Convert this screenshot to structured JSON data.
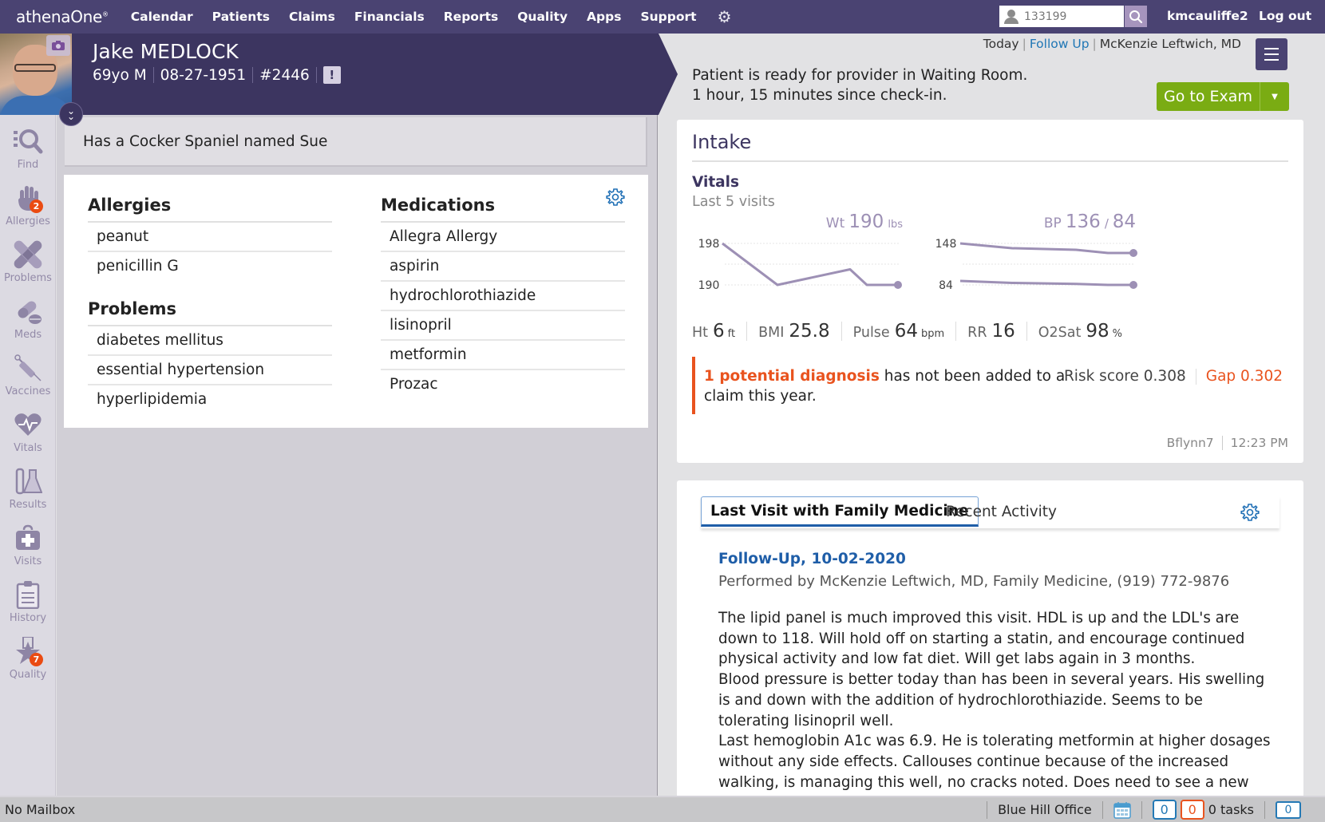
{
  "nav": {
    "logo": "athenaOne",
    "items": [
      "Calendar",
      "Patients",
      "Claims",
      "Financials",
      "Reports",
      "Quality",
      "Apps",
      "Support"
    ],
    "patient_search_value": "133199",
    "username": "kmcauliffe2",
    "logout": "Log out"
  },
  "patient": {
    "name": "Jake MEDLOCK",
    "age_sex": "69yo M",
    "dob": "08-27-1951",
    "id": "#2446",
    "alert_glyph": "!"
  },
  "encounter": {
    "when": "Today",
    "type": "Follow Up",
    "provider": "McKenzie Leftwich, MD",
    "status_line1": "Patient is ready for provider in Waiting Room.",
    "status_line2": "1 hour, 15 minutes since check-in.",
    "exam_button": "Go to Exam"
  },
  "sidebar": {
    "items": [
      {
        "label": "Find",
        "icon": "find-icon"
      },
      {
        "label": "Allergies",
        "icon": "hand-icon",
        "badge": "2"
      },
      {
        "label": "Problems",
        "icon": "bandage-icon"
      },
      {
        "label": "Meds",
        "icon": "pill-icon"
      },
      {
        "label": "Vaccines",
        "icon": "syringe-icon"
      },
      {
        "label": "Vitals",
        "icon": "heart-pulse-icon"
      },
      {
        "label": "Results",
        "icon": "flask-icon"
      },
      {
        "label": "Visits",
        "icon": "medical-bag-icon"
      },
      {
        "label": "History",
        "icon": "clipboard-icon"
      },
      {
        "label": "Quality",
        "icon": "star-icon",
        "badge": "7"
      }
    ]
  },
  "note": "Has a Cocker Spaniel named Sue",
  "allergies": {
    "title": "Allergies",
    "items": [
      "peanut",
      "penicillin G"
    ]
  },
  "problems": {
    "title": "Problems",
    "items": [
      "diabetes mellitus",
      "essential hypertension",
      "hyperlipidemia"
    ]
  },
  "medications": {
    "title": "Medications",
    "items": [
      "Allegra Allergy",
      "aspirin",
      "hydrochlorothiazide",
      "lisinopril",
      "metformin",
      "Prozac"
    ]
  },
  "intake": {
    "title": "Intake",
    "vitals_title": "Vitals",
    "vitals_sub": "Last 5 visits",
    "vitals": [
      {
        "label": "Ht",
        "value": "6",
        "unit": "ft"
      },
      {
        "label": "BMI",
        "value": "25.8",
        "unit": ""
      },
      {
        "label": "Pulse",
        "value": "64",
        "unit": "bpm"
      },
      {
        "label": "RR",
        "value": "16",
        "unit": ""
      },
      {
        "label": "O2Sat",
        "value": "98",
        "unit": "%"
      }
    ],
    "dx_highlight": "1 potential diagnosis",
    "dx_rest": " has not been added to a claim this year.",
    "risk_label": "Risk score 0.308",
    "gap_label": "Gap 0.302",
    "signed_by": "Bflynn7",
    "signed_time": "12:23 PM"
  },
  "chart_data": [
    {
      "type": "line",
      "title": "Wt 190 lbs",
      "label": "Wt",
      "current": "190",
      "unit": "lbs",
      "tick_labels": [
        "198",
        "190"
      ],
      "ylim": [
        190,
        198
      ],
      "x": [
        1,
        2,
        3,
        4,
        5
      ],
      "series": [
        {
          "name": "Weight",
          "values": [
            198,
            190,
            193,
            190,
            190
          ]
        }
      ]
    },
    {
      "type": "line",
      "title": "BP 136 / 84",
      "label": "BP",
      "current": "136",
      "current2": "84",
      "tick_labels": [
        "148",
        "84"
      ],
      "x": [
        1,
        2,
        3,
        4,
        5
      ],
      "series": [
        {
          "name": "Systolic",
          "values": [
            148,
            142,
            140,
            136,
            136
          ]
        },
        {
          "name": "Diastolic",
          "values": [
            88,
            86,
            85,
            84,
            84
          ]
        }
      ]
    }
  ],
  "visit": {
    "tabs": [
      "Last Visit with Family Medicine",
      "Recent Activity"
    ],
    "active_tab": 0,
    "link": "Follow-Up, 10-02-2020",
    "performed_by": "Performed by McKenzie Leftwich, MD, Family Medicine, (919) 772-9876",
    "paragraphs": [
      "The lipid panel is much improved this visit. HDL is up and the LDL's are down to 118. Will hold off on starting a statin, and encourage continued physical activity and low fat diet. Will get labs again in 3 months.",
      "Blood pressure is better today than has been in several years. His swelling is and down with the addition of hydrochlorothiazide. Seems to be tolerating lisinopril well.",
      "Last hemoglobin A1c was 6.9. He is tolerating metformin at higher dosages without any side effects. Callouses continue because of the increased walking, is managing this well, no cracks noted. Does need to see a new eye doctor- he"
    ]
  },
  "statusbar": {
    "mailbox": "No Mailbox",
    "office": "Blue Hill Office",
    "count_blue": "0",
    "count_orange": "0",
    "tasks": "0 tasks",
    "messages": "0"
  },
  "colors": {
    "nav_bg": "#4a4372",
    "header_bg": "#3c3560",
    "accent_green": "#7aac13",
    "alert_orange": "#e9531e",
    "link_blue": "#1f5ea8",
    "chart_line": "#9d90b5"
  }
}
